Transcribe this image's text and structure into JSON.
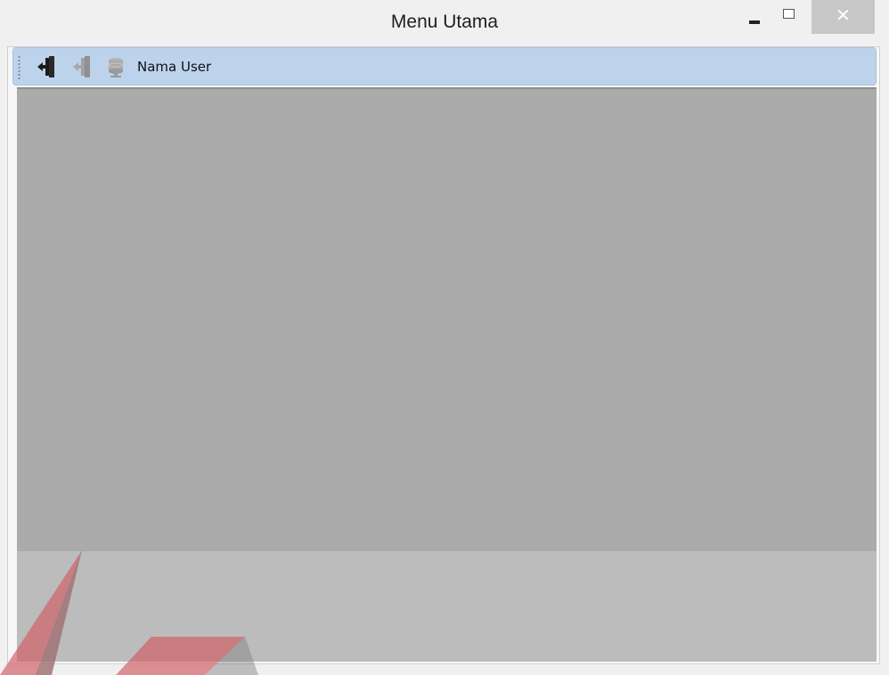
{
  "window": {
    "title": "Menu Utama",
    "controls": {
      "minimize": "minimize-icon",
      "maximize": "maximize-icon",
      "close": "close-icon"
    }
  },
  "toolbar": {
    "buttons": [
      {
        "icon": "login-door-icon",
        "enabled": true
      },
      {
        "icon": "logout-door-icon",
        "enabled": false
      },
      {
        "icon": "database-icon",
        "enabled": false
      }
    ],
    "user_label": "Nama User"
  },
  "colors": {
    "toolbar_bg": "#bdd3ec",
    "mdi_bg": "#ababab",
    "watermark_red": "#cf5b5f",
    "watermark_gray": "#7f7f7f"
  }
}
